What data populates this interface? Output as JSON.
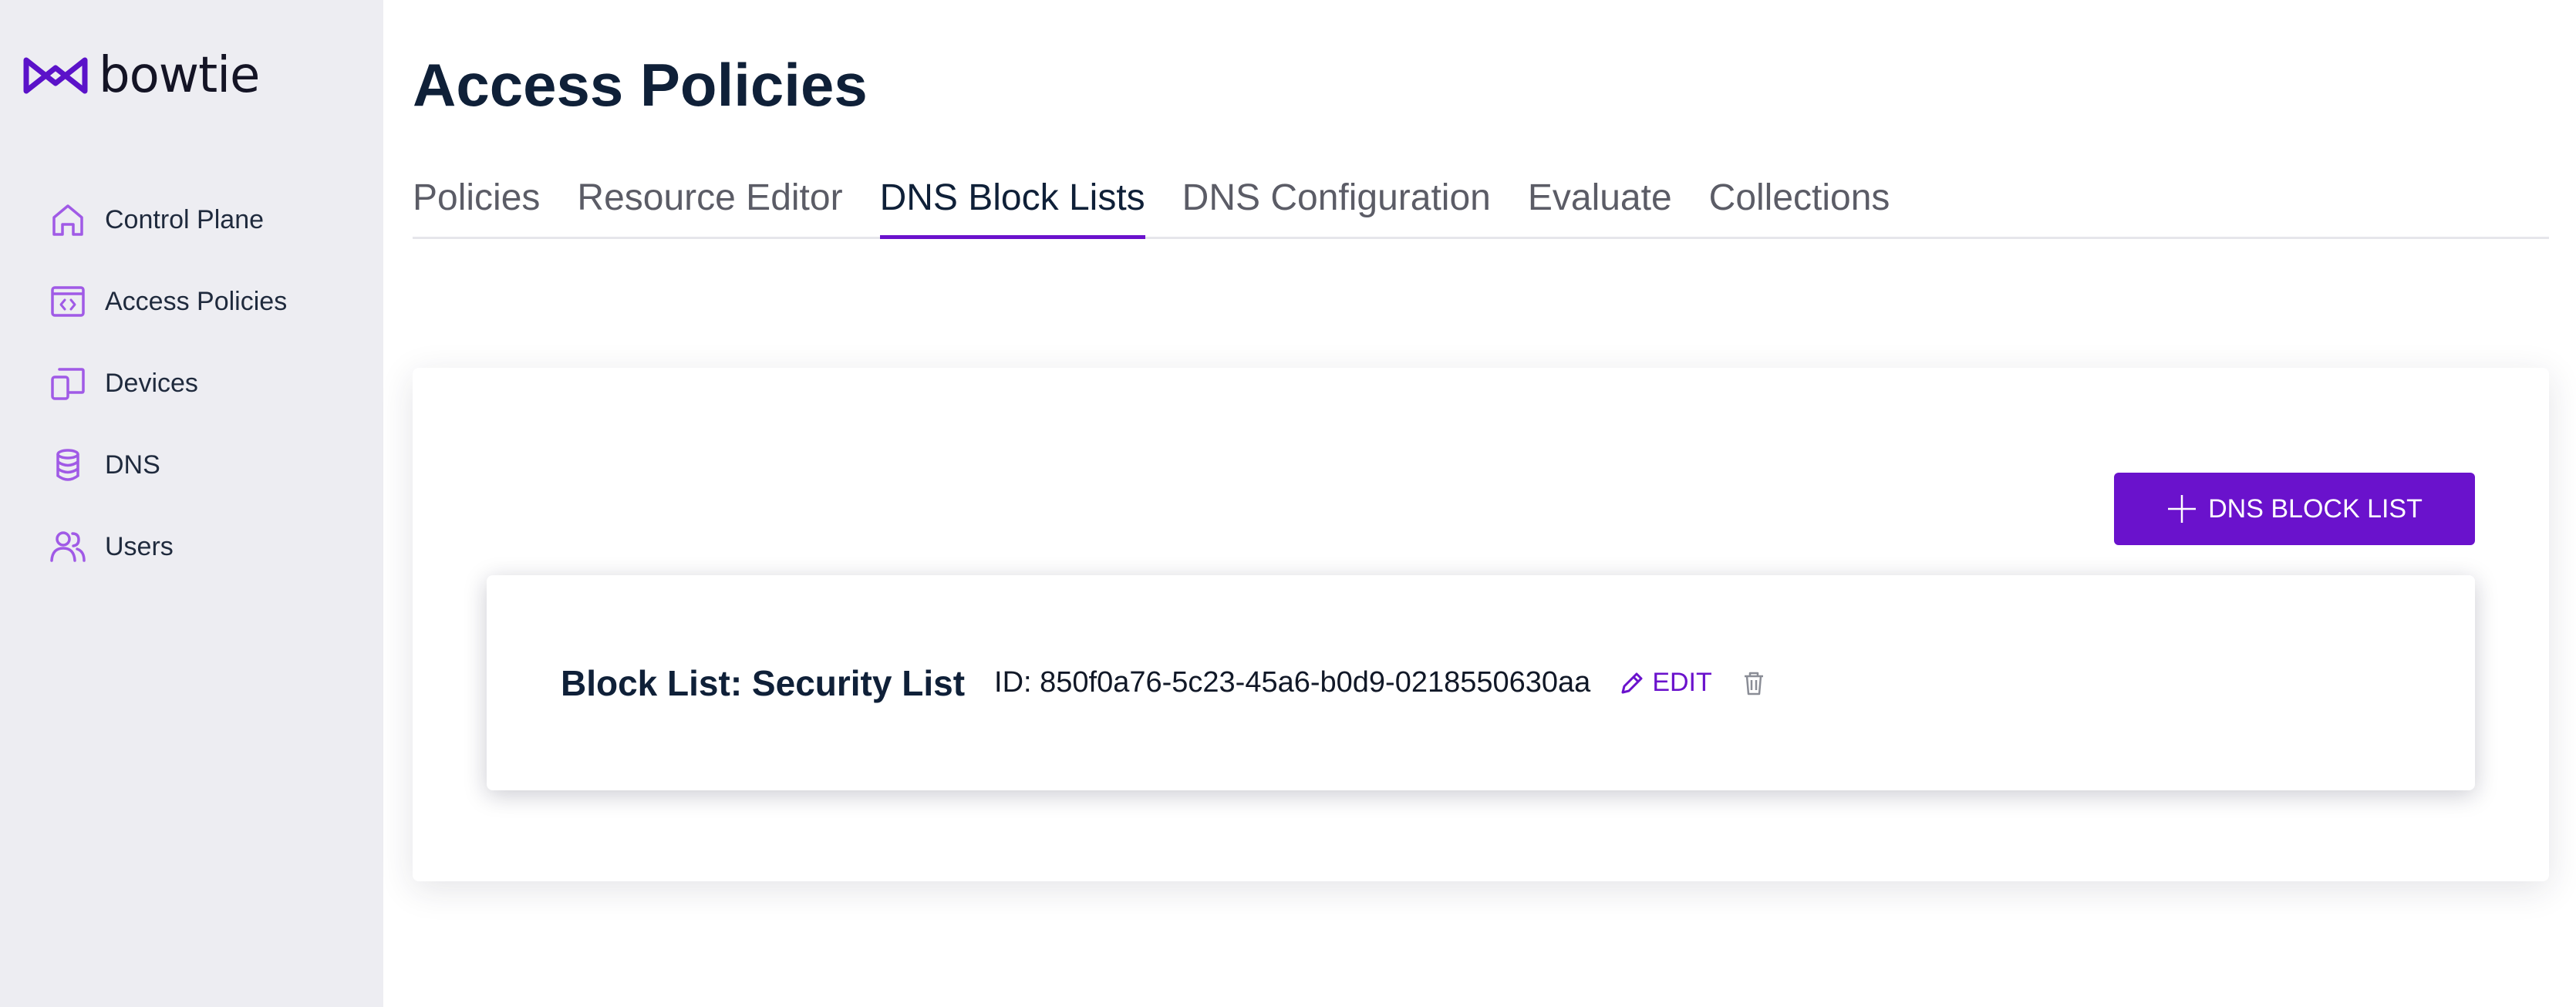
{
  "app": {
    "logo_text": "bowtie"
  },
  "colors": {
    "accent": "#6a12cc",
    "sidebar_bg": "#ededf2",
    "icon_purple": "#a05ae6",
    "heading": "#0f2038"
  },
  "sidebar": {
    "items": [
      {
        "label": "Control Plane",
        "icon": "home-icon"
      },
      {
        "label": "Access Policies",
        "icon": "code-window-icon"
      },
      {
        "label": "Devices",
        "icon": "devices-icon"
      },
      {
        "label": "DNS",
        "icon": "database-icon"
      },
      {
        "label": "Users",
        "icon": "users-icon"
      }
    ]
  },
  "page": {
    "title": "Access Policies"
  },
  "tabs": [
    {
      "label": "Policies",
      "active": false
    },
    {
      "label": "Resource Editor",
      "active": false
    },
    {
      "label": "DNS Block Lists",
      "active": true
    },
    {
      "label": "DNS Configuration",
      "active": false
    },
    {
      "label": "Evaluate",
      "active": false
    },
    {
      "label": "Collections",
      "active": false
    }
  ],
  "panel": {
    "add_button_label": "DNS BLOCK LIST",
    "add_button_icon": "plus-icon"
  },
  "block_list": {
    "title": "Block List: Security List",
    "id_text": "ID: 850f0a76-5c23-45a6-b0d9-0218550630aa",
    "edit_label": "EDIT",
    "edit_icon": "pencil-icon",
    "delete_icon": "trash-icon"
  }
}
